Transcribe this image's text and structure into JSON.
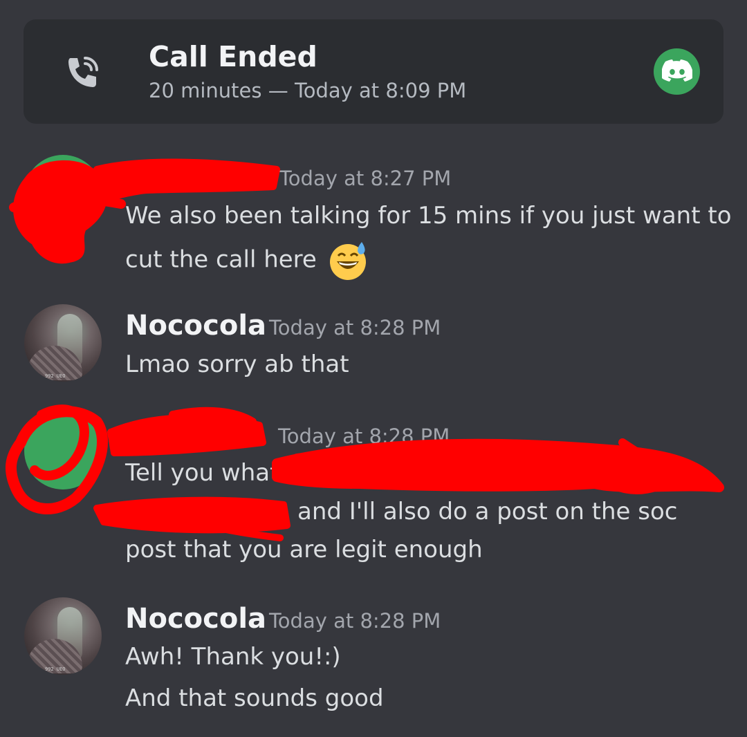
{
  "call": {
    "title": "Call Ended",
    "subtitle": "20 minutes — Today at 8:09 PM",
    "icon": "phone-call-icon",
    "badge_icon": "discord-icon",
    "badge_color": "#3ba55d"
  },
  "messages": [
    {
      "author": "",
      "time": "Today at 8:27 PM",
      "lines": [
        "We also been talking for 15 mins if you just want to",
        "cut the call here"
      ],
      "emoji": "sweat-smile-emoji",
      "redacted": true
    },
    {
      "author": "Nococola",
      "time": "Today at 8:28 PM",
      "lines": [
        "Lmao sorry ab that"
      ],
      "avatar_text": "992 UEO"
    },
    {
      "author": "",
      "time": "Today at 8:28 PM",
      "lines": [
        "Tell you what",
        "and I'll also do a post on the soc",
        "post that you are legit enough"
      ],
      "redacted": true
    },
    {
      "author": "Nococola",
      "time": "Today at 8:28 PM",
      "lines": [
        "Awh! Thank you!:)",
        "And that sounds good"
      ],
      "avatar_text": "992 UEO"
    }
  ],
  "colors": {
    "background": "#36373d",
    "card": "#2b2d31",
    "redaction": "#ff0000"
  }
}
